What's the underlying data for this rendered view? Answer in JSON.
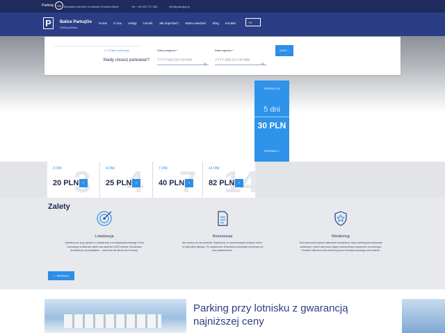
{
  "topbar": {
    "badge_word": "Parking",
    "badge_num": "24h",
    "transfer": "Bezpłatny transfer na lotnisko Kraków-Balice",
    "phone": "tel: +48 533 727 585",
    "email": "info@parkujgo.pl"
  },
  "nav": {
    "logo_letter": "P",
    "brand_name": "Balice ParkujGo",
    "brand_sub": "Parking Balice",
    "items": [
      "Home",
      "O nas",
      "Usługi",
      "Cennik",
      "Jak dojechać?",
      "Warto wiedzieć",
      "Blog",
      "Kontakt"
    ],
    "lang": "PL"
  },
  "form": {
    "step": "1 / 4 Data rezerwacji",
    "question": "Kiedy chcesz parkować?",
    "arrival_label": "Data przyjazdu *",
    "arrival_placeholder": "YYYY-MM-DD HH:MM",
    "departure_label": "Data wyjazdu *",
    "departure_placeholder": "YYYY-MM-DD HH:MM",
    "next": "DALEJ",
    "icon": "calendar-icon"
  },
  "promo": {
    "label": "PROMOCJA",
    "days": "5 dni",
    "price": "30 PLN",
    "reserve": "REZERWUJ"
  },
  "prices": [
    {
      "days": "3 DNI",
      "ghost": "3",
      "price": "20 PLN"
    },
    {
      "days": "4 DNI",
      "ghost": "4",
      "price": "25 PLN"
    },
    {
      "days": "7 DNI",
      "ghost": "7",
      "price": "40 PLN"
    },
    {
      "days": "14 DNI",
      "ghost": "14",
      "price": "82 PLN"
    }
  ],
  "zalety": {
    "title": "Zalety",
    "features": [
      {
        "icon": "target-icon",
        "title": "Lokalizacja",
        "desc": "Jesteśmy tuż przy zjeździe z autostrady, a od Międzynarodowego Portu Lotniczego w Balicach dzieli nas zaledwie 1200 metrów. Na lotnisko dowieziemy cię bezpłatnie – kurs trwa nie dłużej niż 3 minuty."
      },
      {
        "icon": "document-icon",
        "title": "Rezerwacja",
        "desc": "Nie musisz do nas dzwonić. Wystarczy, że zarezerwujesz miejsce online. To tylko kilka kliknięć. Po wypełnieniu formularza rezerwacji otrzymasz od nas potwierdzenie."
      },
      {
        "icon": "shield-star-icon",
        "title": "Monitoring",
        "desc": "Twój samochód będzie całkowicie bezpieczny. Nasz parking jest doskonale oświetlony i przez całą dobę objęty nowoczesnym systemem monitoringu. Ponadto cały teren jest strzeżony przez licencjonowanego ochroniarza."
      }
    ],
    "reserve": "REZERWUJ"
  },
  "bottom": {
    "headline": "Parking przy lotnisku z gwarancją najniższej ceny"
  },
  "colors": {
    "navy": "#2b3d84",
    "accent": "#2d8ee6"
  }
}
